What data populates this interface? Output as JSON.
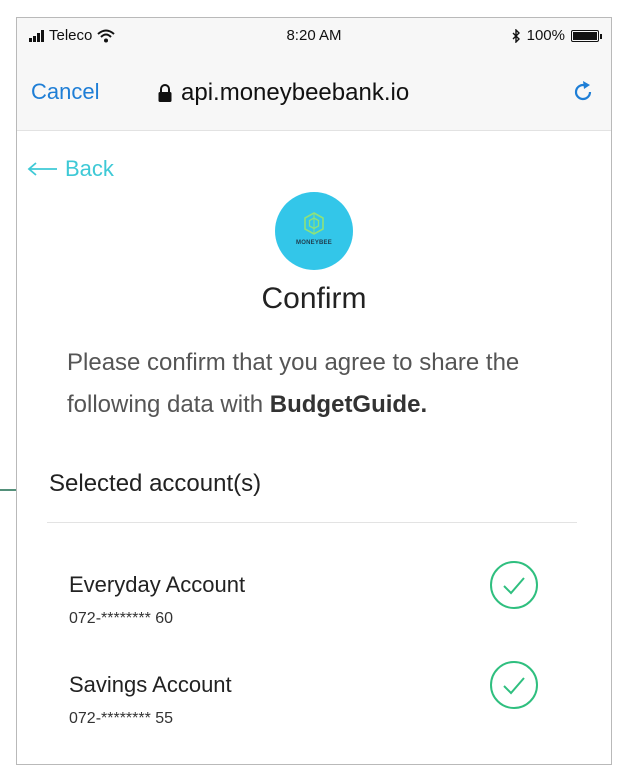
{
  "status_bar": {
    "carrier": "Teleco",
    "time": "8:20 AM",
    "battery": "100%",
    "battery_level": 1.0
  },
  "nav": {
    "cancel_label": "Cancel",
    "url": "api.moneybeebank.io"
  },
  "page": {
    "back_label": "Back",
    "logo_text": "MONEYBEE",
    "title": "Confirm",
    "description_prefix": "Please confirm that you agree to share the following data with ",
    "recipient": "BudgetGuide.",
    "section_heading": "Selected account(s)",
    "accounts": [
      {
        "name": "Everyday Account",
        "number": "072-******** 60",
        "selected": true
      },
      {
        "name": "Savings Account",
        "number": "072-******** 55",
        "selected": true
      }
    ]
  },
  "colors": {
    "link": "#1e7ed6",
    "back": "#3ec9d6",
    "logo": "#33c6e9",
    "check": "#2fbf7f",
    "annotation_arrow": "#1b6b4e"
  },
  "icons": [
    "signal-icon",
    "wifi-icon",
    "bluetooth-icon",
    "battery-icon",
    "lock-icon",
    "reload-icon",
    "back-arrow-icon",
    "hexagon-logo-icon",
    "check-circle-icon"
  ]
}
